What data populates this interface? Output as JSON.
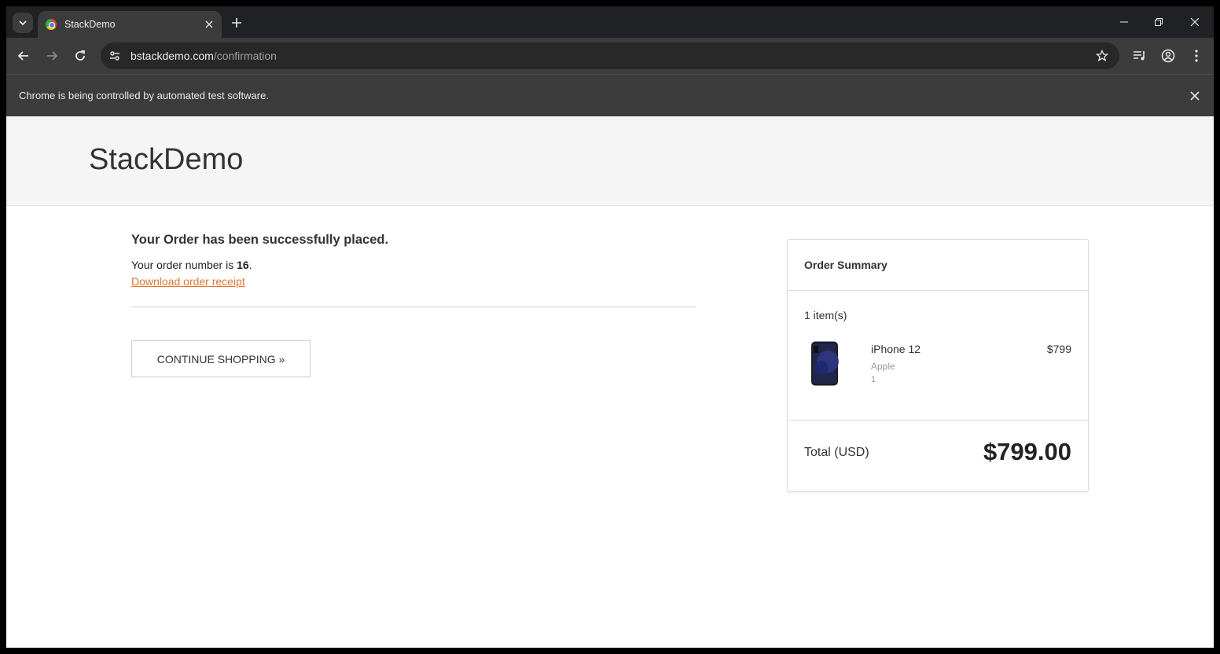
{
  "browser": {
    "tab_title": "StackDemo",
    "url_host": "bstackdemo.com",
    "url_path": "/confirmation",
    "infobar_message": "Chrome is being controlled by automated test software."
  },
  "site": {
    "logo": "StackDemo"
  },
  "confirmation": {
    "heading": "Your Order has been successfully placed.",
    "order_prefix": "Your order number is ",
    "order_number": "16",
    "order_suffix": ".",
    "download_link": "Download order receipt",
    "continue_button": "CONTINUE SHOPPING »"
  },
  "summary": {
    "title": "Order Summary",
    "item_count": "1 item(s)",
    "items": [
      {
        "name": "iPhone 12",
        "brand": "Apple",
        "quantity": "1",
        "price": "$799"
      }
    ],
    "total_label": "Total (USD)",
    "total_value": "$799.00"
  },
  "colors": {
    "link": "#e0762f",
    "header_bg": "#f5f5f5",
    "chrome_dark": "#202124",
    "chrome_toolbar": "#3c3c3c"
  }
}
